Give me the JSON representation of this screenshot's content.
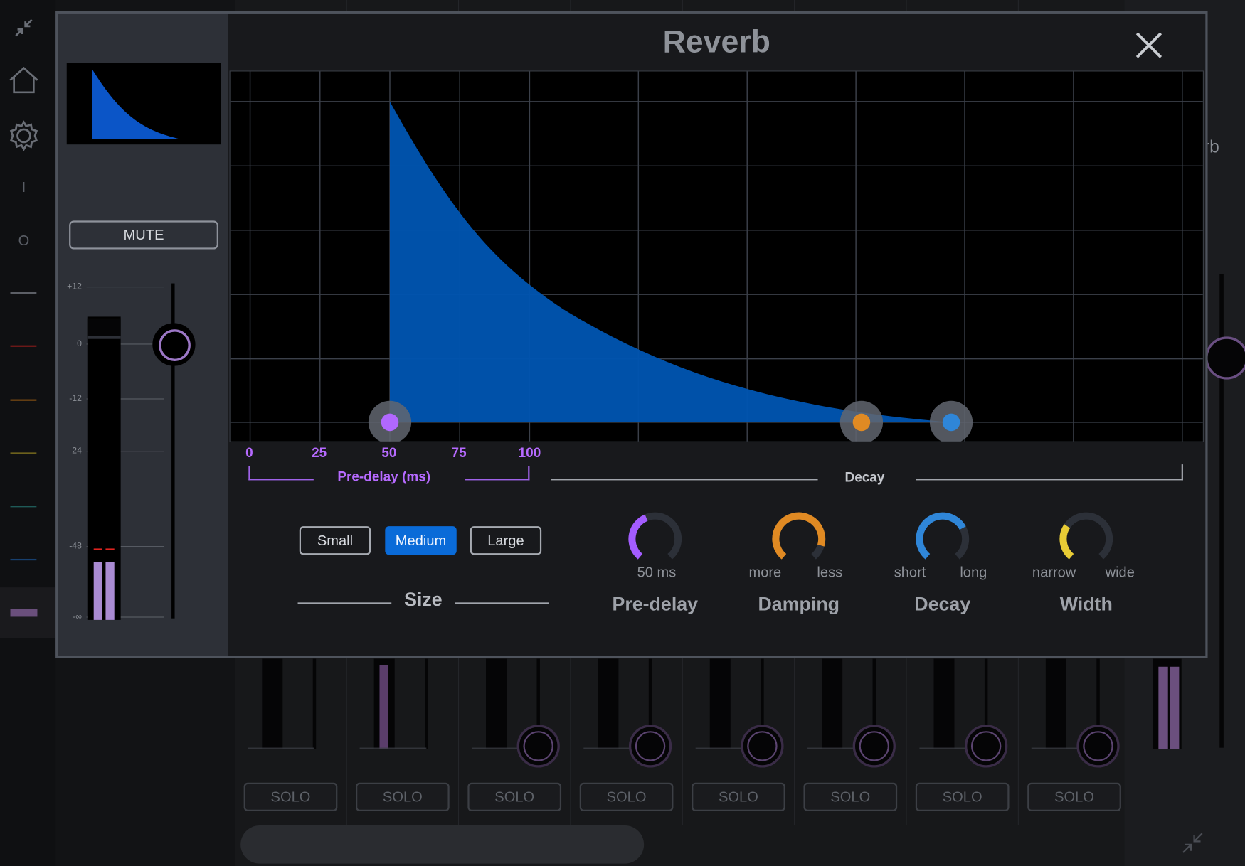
{
  "background": {
    "right_label": "rb",
    "solo_labels": [
      "SOLO",
      "SOLO",
      "SOLO",
      "SOLO",
      "SOLO",
      "SOLO",
      "SOLO",
      "SOLO"
    ],
    "nav_line_colors": [
      "#5c5f66",
      "#7a1a1a",
      "#7a4a12",
      "#6c611c",
      "#1f5a57",
      "#17406f"
    ]
  },
  "sidebar": {
    "items": [
      {
        "name": "collapse",
        "icon": "collapse-arrows-icon"
      },
      {
        "name": "home",
        "icon": "home-icon"
      },
      {
        "name": "settings",
        "icon": "gear-icon"
      },
      {
        "name": "input",
        "text": "I"
      },
      {
        "name": "output",
        "text": "O"
      }
    ]
  },
  "modal": {
    "title": "Reverb",
    "close_icon": "close-icon",
    "mute_label": "MUTE",
    "meter_scale": [
      "+12",
      "0",
      "-12",
      "-24",
      "-48",
      "-∞"
    ],
    "meter_levels": [
      0.19,
      0.19
    ],
    "graph": {
      "x_ticks": [
        "0",
        "25",
        "50",
        "75",
        "100"
      ],
      "predelay_label": "Pre-delay (ms)",
      "decay_label": "Decay",
      "handles": [
        {
          "name": "pre-delay",
          "color": "#b168ff"
        },
        {
          "name": "damping",
          "color": "#e08a23"
        },
        {
          "name": "decay",
          "color": "#2f86d8"
        }
      ]
    },
    "size": {
      "title": "Size",
      "options": [
        "Small",
        "Medium",
        "Large"
      ],
      "selected": "Medium"
    },
    "knobs": [
      {
        "title": "Pre-delay",
        "value_label": "50 ms",
        "color": "#a35cff",
        "fraction": 0.42
      },
      {
        "title": "Damping",
        "left_label": "more",
        "right_label": "less",
        "color": "#e08a23",
        "fraction": 0.88
      },
      {
        "title": "Decay",
        "left_label": "short",
        "right_label": "long",
        "color": "#2f86d8",
        "fraction": 0.72
      },
      {
        "title": "Width",
        "left_label": "narrow",
        "right_label": "wide",
        "color": "#e8cc35",
        "fraction": 0.3
      }
    ]
  }
}
